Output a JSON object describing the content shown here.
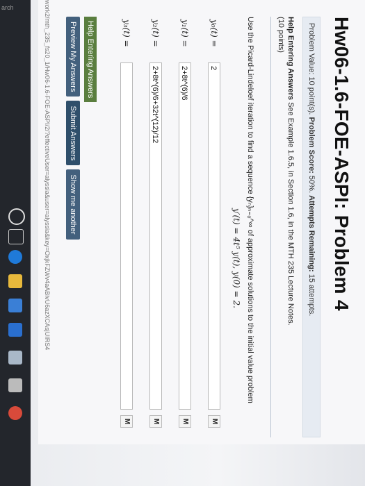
{
  "title": "Hw06-1.6-FOE-ASPI: Problem 4",
  "meta": {
    "problem_value_label": "Problem Value:",
    "problem_value": "10 point(s).",
    "score_label": "Problem Score:",
    "score": "50%.",
    "attempts_label": "Attempts Remaining:",
    "attempts": "15 attempts."
  },
  "help": {
    "label": "Help Entering Answers",
    "text": "See Example 1.6.5, in Section 1.6, in the MTH 235 Lecture Notes.",
    "points": "(10 points)"
  },
  "question": "Use the Picard-Lindeloef iteration to find a sequence {yₙ}ₙ₌₀^∞ of approximate solutions to the initial value problem",
  "equation": "y′(t) = 4t⁵ y(t),     y(0) = 2.",
  "answers": [
    {
      "label": "y₀(t) =",
      "value": "2"
    },
    {
      "label": "y₁(t) =",
      "value": "2+8t^(6)/6"
    },
    {
      "label": "y₂(t) =",
      "value": "2+8t^(6)/6+32t^(12)/12"
    },
    {
      "label": "y₃(t) =",
      "value": ""
    }
  ],
  "m_button": "M",
  "help_link": "Help Entering Answers",
  "buttons": {
    "preview": "Preview My Answers",
    "submit": "Submit Answers",
    "show": "Show me another"
  },
  "url_text": "work2/mth_235_fs20_1/Hw06-1.6-FOE-ASPI/2/?effectiveUser=alyssia&user=alyssia&key=OxjkFZWv4aABivU6azXCAsjUIRS4",
  "search_text": "arch"
}
